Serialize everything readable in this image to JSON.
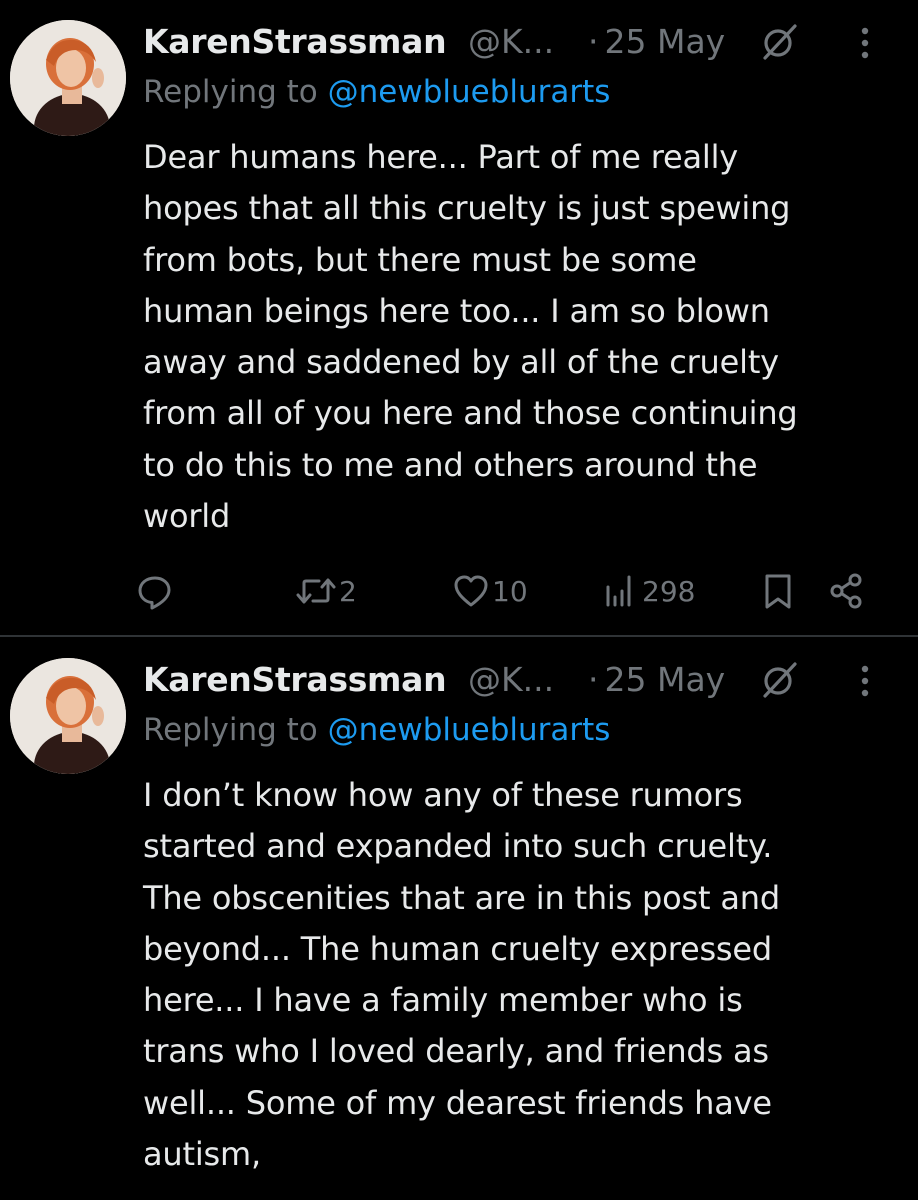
{
  "tweets": [
    {
      "author_name": "KarenStrassman",
      "handle": "@K...",
      "separator": "·",
      "date": "25 May",
      "replying_prefix": "Replying to ",
      "replying_mention": "@newblueblurarts",
      "text": "Dear humans here... Part of me really\nhopes that all this cruelty is just spewing\nfrom bots, but there must be some\nhuman beings here too... I am so blown\naway and saddened by all of the cruelty\nfrom all of you here and those continuing\nto do this to me and others around the\nworld",
      "reposts": "2",
      "likes": "10",
      "views": "298"
    },
    {
      "author_name": "KarenStrassman",
      "handle": "@K...",
      "separator": "·",
      "date": "25 May",
      "replying_prefix": "Replying to ",
      "replying_mention": "@newblueblurarts",
      "text": "I don’t know how any of these rumors\nstarted and expanded into such cruelty.\nThe obscenities that are in this post and\nbeyond... The human cruelty expressed\nhere... I have a family member who is\ntrans who I loved dearly, and friends as\nwell... Some of my dearest friends have\nautism,"
    }
  ],
  "colors": {
    "background": "#000000",
    "text_primary": "#e7e9ea",
    "text_secondary": "#71767b",
    "link": "#1d9bf0",
    "divider": "#2f3336"
  },
  "icons": {
    "reply": "reply-icon",
    "repost": "repost-icon",
    "like": "heart-icon",
    "views": "views-icon",
    "bookmark": "bookmark-icon",
    "share": "share-icon",
    "grok": "grok-icon",
    "more": "more-icon"
  }
}
